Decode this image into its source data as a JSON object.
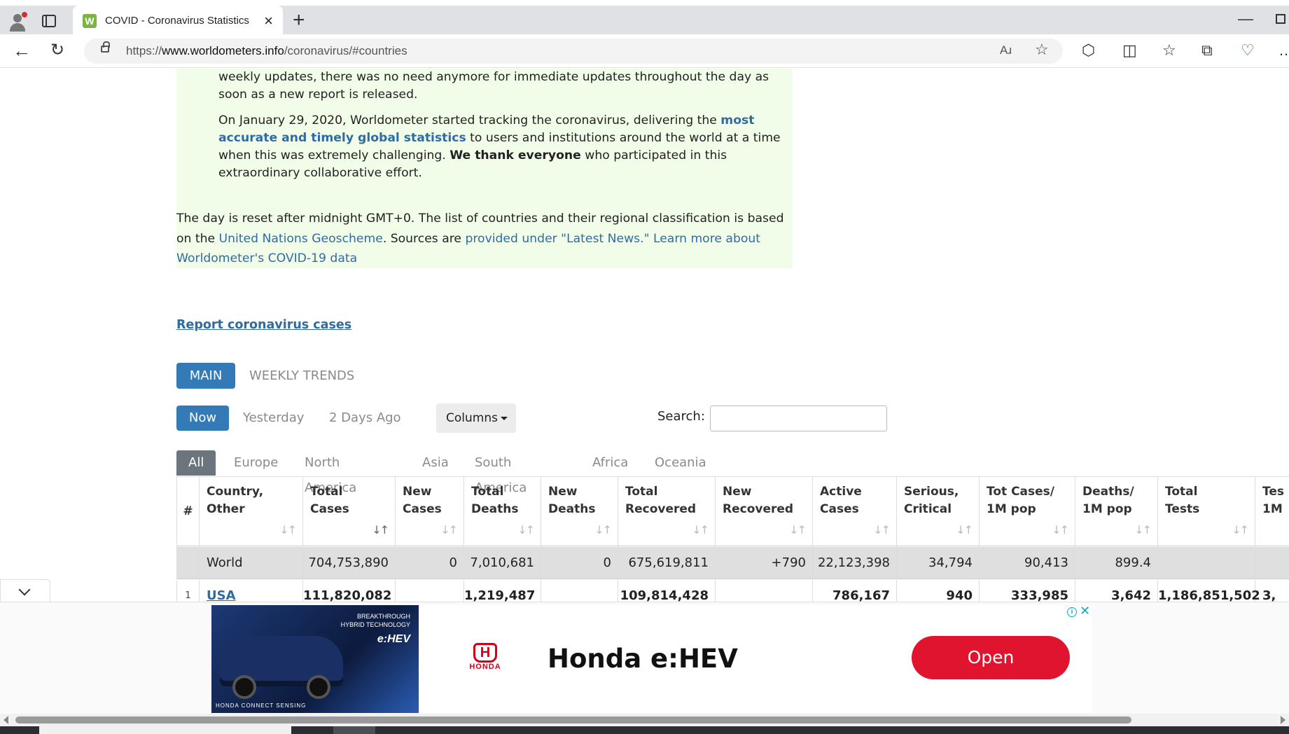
{
  "browser": {
    "tab_title": "COVID - Coronavirus Statistics - W",
    "tab_favicon": "W",
    "url_prefix": "https://",
    "url_domain": "www.worldometers.info",
    "url_path": "/coronavirus/#countries",
    "read_aloud": "Aɹ",
    "icons": [
      "profile-icon",
      "tabs-icon",
      "close-icon",
      "new-tab-icon",
      "back-icon",
      "refresh-icon",
      "lock-icon",
      "read-aloud-icon",
      "favorite-icon",
      "extensions-icon",
      "split-screen-icon",
      "favorites-icon",
      "collections-icon",
      "health-icon",
      "more-icon",
      "minimize-icon",
      "maximize-icon"
    ]
  },
  "notice": {
    "para1": "weekly updates, there was no need anymore for immediate updates throughout the day as soon as a new report is released.",
    "para2_a": "On January 29, 2020, Worldometer started tracking the coronavirus, delivering the ",
    "para2_link": "most accurate and timely global statistics",
    "para2_b": " to users and institutions around the world at a time when this was extremely challenging. ",
    "para2_strong": "We thank everyone",
    "para2_c": " who participated in this extraordinary collaborative effort."
  },
  "info": {
    "text_a": "The day is reset after midnight GMT+0. The list of countries and their regional classification is based on the ",
    "link_un": "United Nations Geoscheme",
    "text_b": ". Sources are ",
    "link_sources": "provided under \"Latest News.\"",
    "text_c": " ",
    "link_learn": "Learn more about Worldometer's COVID-19 data"
  },
  "report_link": "Report coronavirus cases",
  "view_tabs": {
    "main": "MAIN",
    "weekly": "WEEKLY TRENDS"
  },
  "day_tabs": {
    "now": "Now",
    "yesterday": "Yesterday",
    "two_days": "2 Days Ago"
  },
  "columns_button": "Columns",
  "search": {
    "label": "Search:",
    "value": "",
    "placeholder": ""
  },
  "regions": [
    "All",
    "Europe",
    "North America",
    "Asia",
    "South America",
    "Africa",
    "Oceania"
  ],
  "table": {
    "headers": [
      [
        "#",
        ""
      ],
      [
        "Country,",
        "Other"
      ],
      [
        "Total",
        "Cases"
      ],
      [
        "New",
        "Cases"
      ],
      [
        "Total",
        "Deaths"
      ],
      [
        "New",
        "Deaths"
      ],
      [
        "Total",
        "Recovered"
      ],
      [
        "New",
        "Recovered"
      ],
      [
        "Active",
        "Cases"
      ],
      [
        "Serious,",
        "Critical"
      ],
      [
        "Tot Cases/",
        "1M pop"
      ],
      [
        "Deaths/",
        "1M pop"
      ],
      [
        "Total",
        "Tests"
      ],
      [
        "Tes",
        "1M"
      ]
    ],
    "sort_icon": "↓↑",
    "world": [
      "",
      "World",
      "704,753,890",
      "0",
      "7,010,681",
      "0",
      "675,619,811",
      "+790",
      "22,123,398",
      "34,794",
      "90,413",
      "899.4",
      "",
      ""
    ],
    "usa": [
      "1",
      "USA",
      "111,820,082",
      "",
      "1,219,487",
      "",
      "109,814,428",
      "",
      "786,167",
      "940",
      "333,985",
      "3,642",
      "1,186,851,502",
      "3,"
    ]
  },
  "ad": {
    "image_line1": "BREAKTHROUGH",
    "image_line2": "HYBRID TECHNOLOGY",
    "image_badge": "e:HEV",
    "image_footer": "HONDA  CONNECT  SENSING",
    "logo_word": "HONDA",
    "logo_h": "H",
    "title": "Honda e:HEV",
    "open_label": "Open",
    "info_glyph": "i",
    "close_glyph": "✕"
  }
}
